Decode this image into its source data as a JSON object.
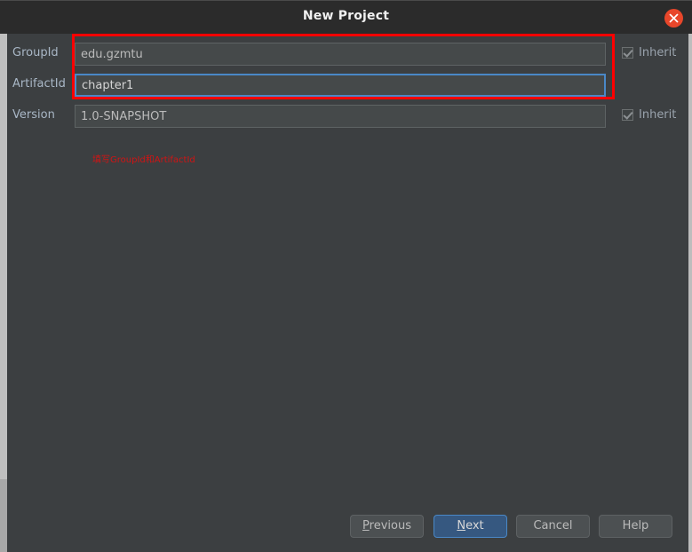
{
  "window": {
    "title": "New Project",
    "close_icon": "close-circle-icon"
  },
  "form": {
    "rows": [
      {
        "label": "GroupId",
        "value": "edu.gzmtu",
        "focused": false,
        "inherit_label": "Inherit",
        "inherit_checked": true
      },
      {
        "label": "ArtifactId",
        "value": "chapter1",
        "focused": true,
        "inherit_label": "",
        "inherit_checked": false
      },
      {
        "label": "Version",
        "value": "1.0-SNAPSHOT",
        "focused": false,
        "inherit_label": "Inherit",
        "inherit_checked": true
      }
    ]
  },
  "annotations": {
    "highlight_color": "#fe0000",
    "note_text": "填写GroupId和ArtifactId",
    "note_color": "#d01414"
  },
  "buttons": {
    "previous": {
      "label": "Previous",
      "mnemonic": "P"
    },
    "next": {
      "label": "Next",
      "mnemonic": "N",
      "primary": true
    },
    "cancel": {
      "label": "Cancel",
      "mnemonic": ""
    },
    "help": {
      "label": "Help",
      "mnemonic": ""
    }
  },
  "colors": {
    "titlebar_bg": "#2b2b2b",
    "body_bg": "#3c3f41",
    "field_bg": "#45494a",
    "accent_blue": "#4a88c7",
    "primary_btn_bg": "#365880",
    "close_btn_bg": "#e8462a"
  }
}
